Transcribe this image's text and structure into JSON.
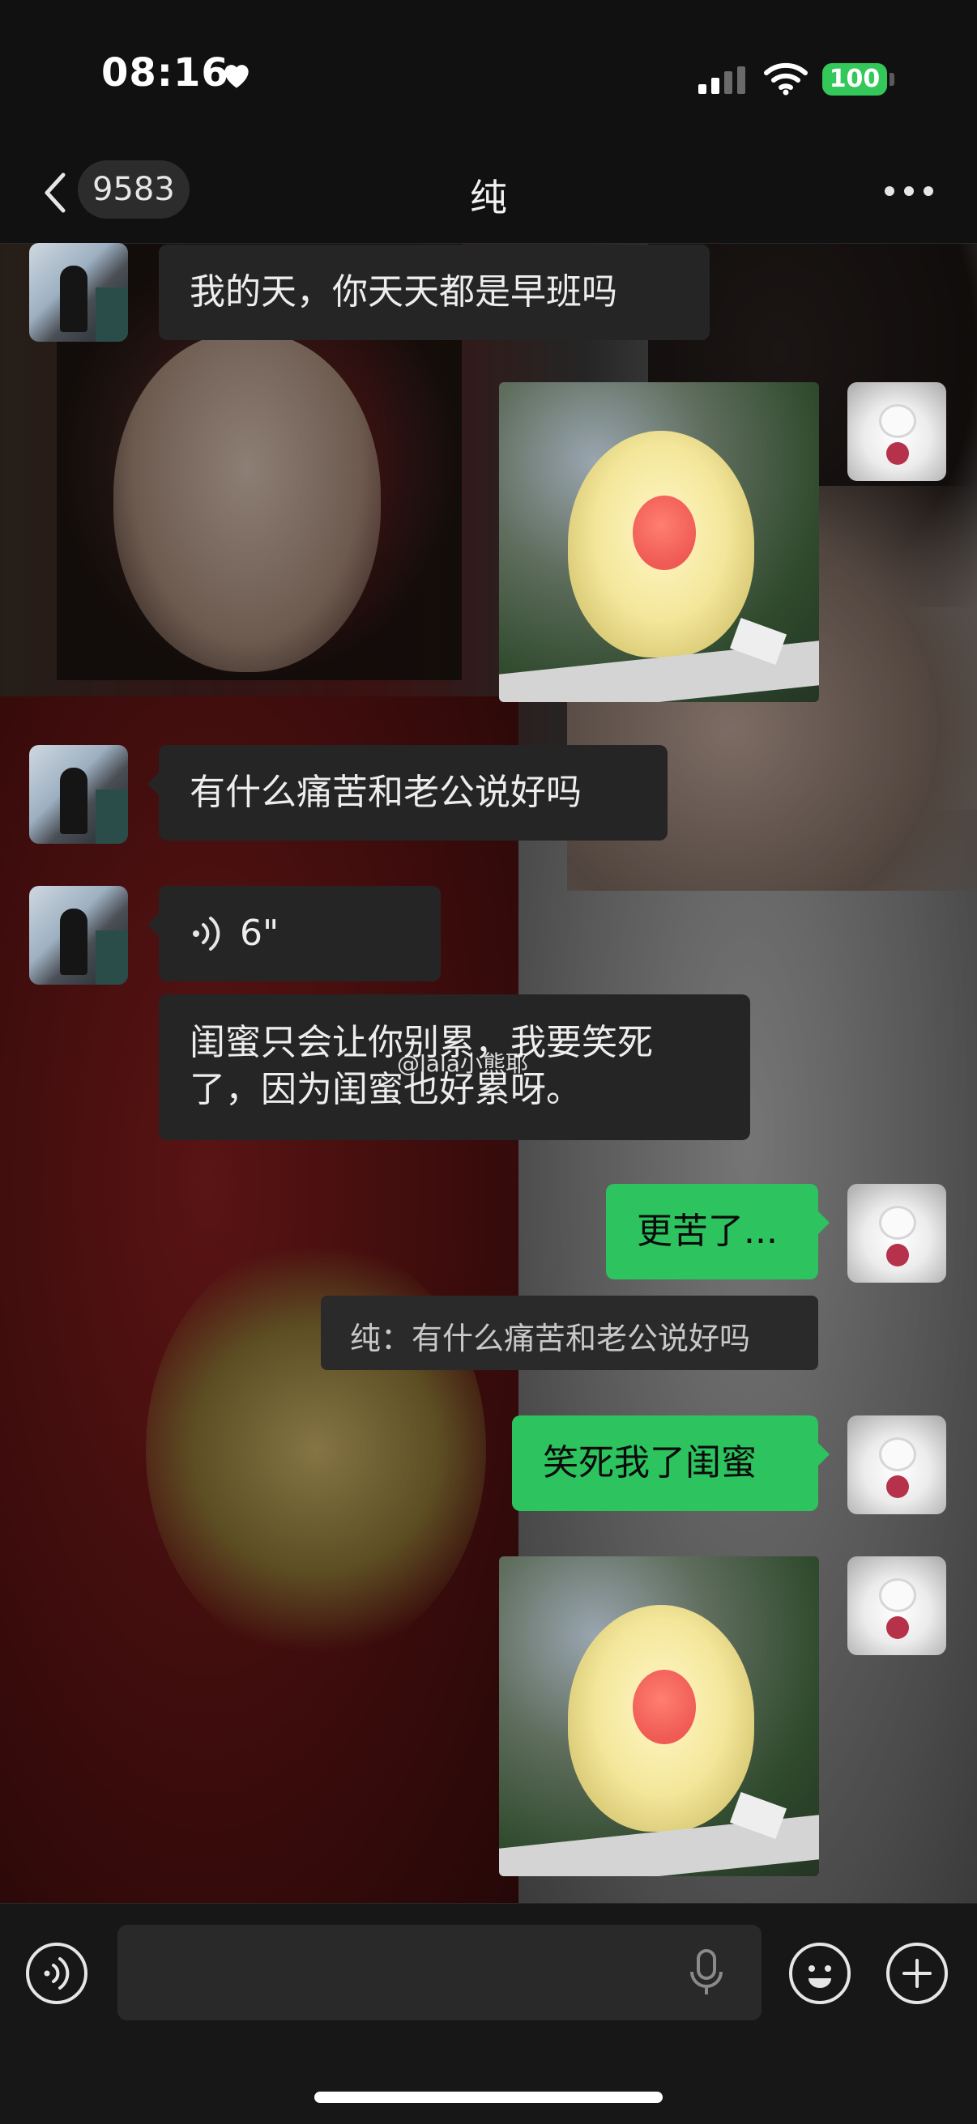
{
  "status_bar": {
    "time": "08:16",
    "battery": "100"
  },
  "header": {
    "back_badge": "9583",
    "title": "纯"
  },
  "messages": [
    {
      "side": "left",
      "type": "text",
      "text": "我的天，你天天都是早班吗"
    },
    {
      "side": "right",
      "type": "image",
      "image": "fluffy-yellow-toy-photo"
    },
    {
      "side": "left",
      "type": "text",
      "text": "有什么痛苦和老公说好吗"
    },
    {
      "side": "left",
      "type": "voice",
      "duration": "6\""
    },
    {
      "side": "left",
      "type": "text",
      "line1": "闺蜜只会让你别累，我要笑死",
      "line2": "了，因为闺蜜也好累呀。"
    },
    {
      "side": "right",
      "type": "text",
      "text": "更苦了..."
    },
    {
      "type": "quote",
      "text": "纯：有什么痛苦和老公说好吗"
    },
    {
      "side": "right",
      "type": "text",
      "text": "笑死我了闺蜜"
    },
    {
      "side": "right",
      "type": "image",
      "image": "fluffy-yellow-toy-photo"
    }
  ],
  "watermark": "@lala小熊耶",
  "colors": {
    "outgoing": "#2dc35e",
    "incoming": "#252525",
    "battery": "#34c759"
  }
}
